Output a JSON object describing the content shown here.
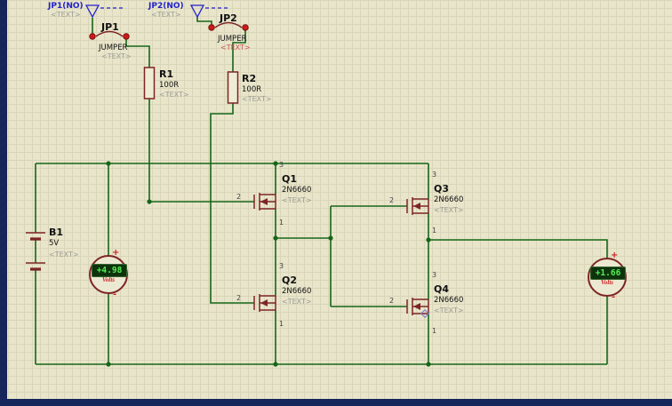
{
  "colors": {
    "bg": "#e8e5cb",
    "grid": "#d9d5b8",
    "wire": "#156617",
    "comp": "#7d2525",
    "probe": "#2222cc",
    "pin-red": "#cc1a1a",
    "navy": "#17265a",
    "placeholder": "#9c9c94",
    "placeholder-red": "#cc5555",
    "lcd-bg": "#0d330d",
    "lcd-fg": "#55ee55",
    "meter-red": "#cc2222",
    "text": "#111111",
    "pin-label": "#444444"
  },
  "probes": [
    {
      "label": "JP1(NO)",
      "text": "<TEXT>"
    },
    {
      "label": "JP2(NO)",
      "text": "<TEXT>"
    }
  ],
  "jumpers": [
    {
      "ref": "JP1",
      "value": "JUMPER",
      "text": "<TEXT>"
    },
    {
      "ref": "JP2",
      "value": "JUMPER",
      "text": "<TEXT>"
    }
  ],
  "resistors": [
    {
      "ref": "R1",
      "value": "100R",
      "text": "<TEXT>"
    },
    {
      "ref": "R2",
      "value": "100R",
      "text": "<TEXT>"
    }
  ],
  "transistors": [
    {
      "ref": "Q1",
      "part": "2N6660",
      "text": "<TEXT>",
      "pin_drain": "3",
      "pin_gate": "2",
      "pin_source": "1"
    },
    {
      "ref": "Q2",
      "part": "2N6660",
      "text": "<TEXT>",
      "pin_drain": "3",
      "pin_gate": "2",
      "pin_source": "1"
    },
    {
      "ref": "Q3",
      "part": "2N6660",
      "text": "<TEXT>",
      "pin_drain": "3",
      "pin_gate": "2",
      "pin_source": "1"
    },
    {
      "ref": "Q4",
      "part": "2N6660",
      "text": "<TEXT>",
      "pin_drain": "3",
      "pin_gate": "2",
      "pin_source": "1"
    }
  ],
  "battery": {
    "ref": "B1",
    "value": "5V",
    "text": "<TEXT>"
  },
  "meters": [
    {
      "reading": "+4.98",
      "unit": "Volts",
      "plus": "+",
      "minus": "-"
    },
    {
      "reading": "+1.66",
      "unit": "Volts",
      "plus": "+",
      "minus": "-"
    }
  ]
}
